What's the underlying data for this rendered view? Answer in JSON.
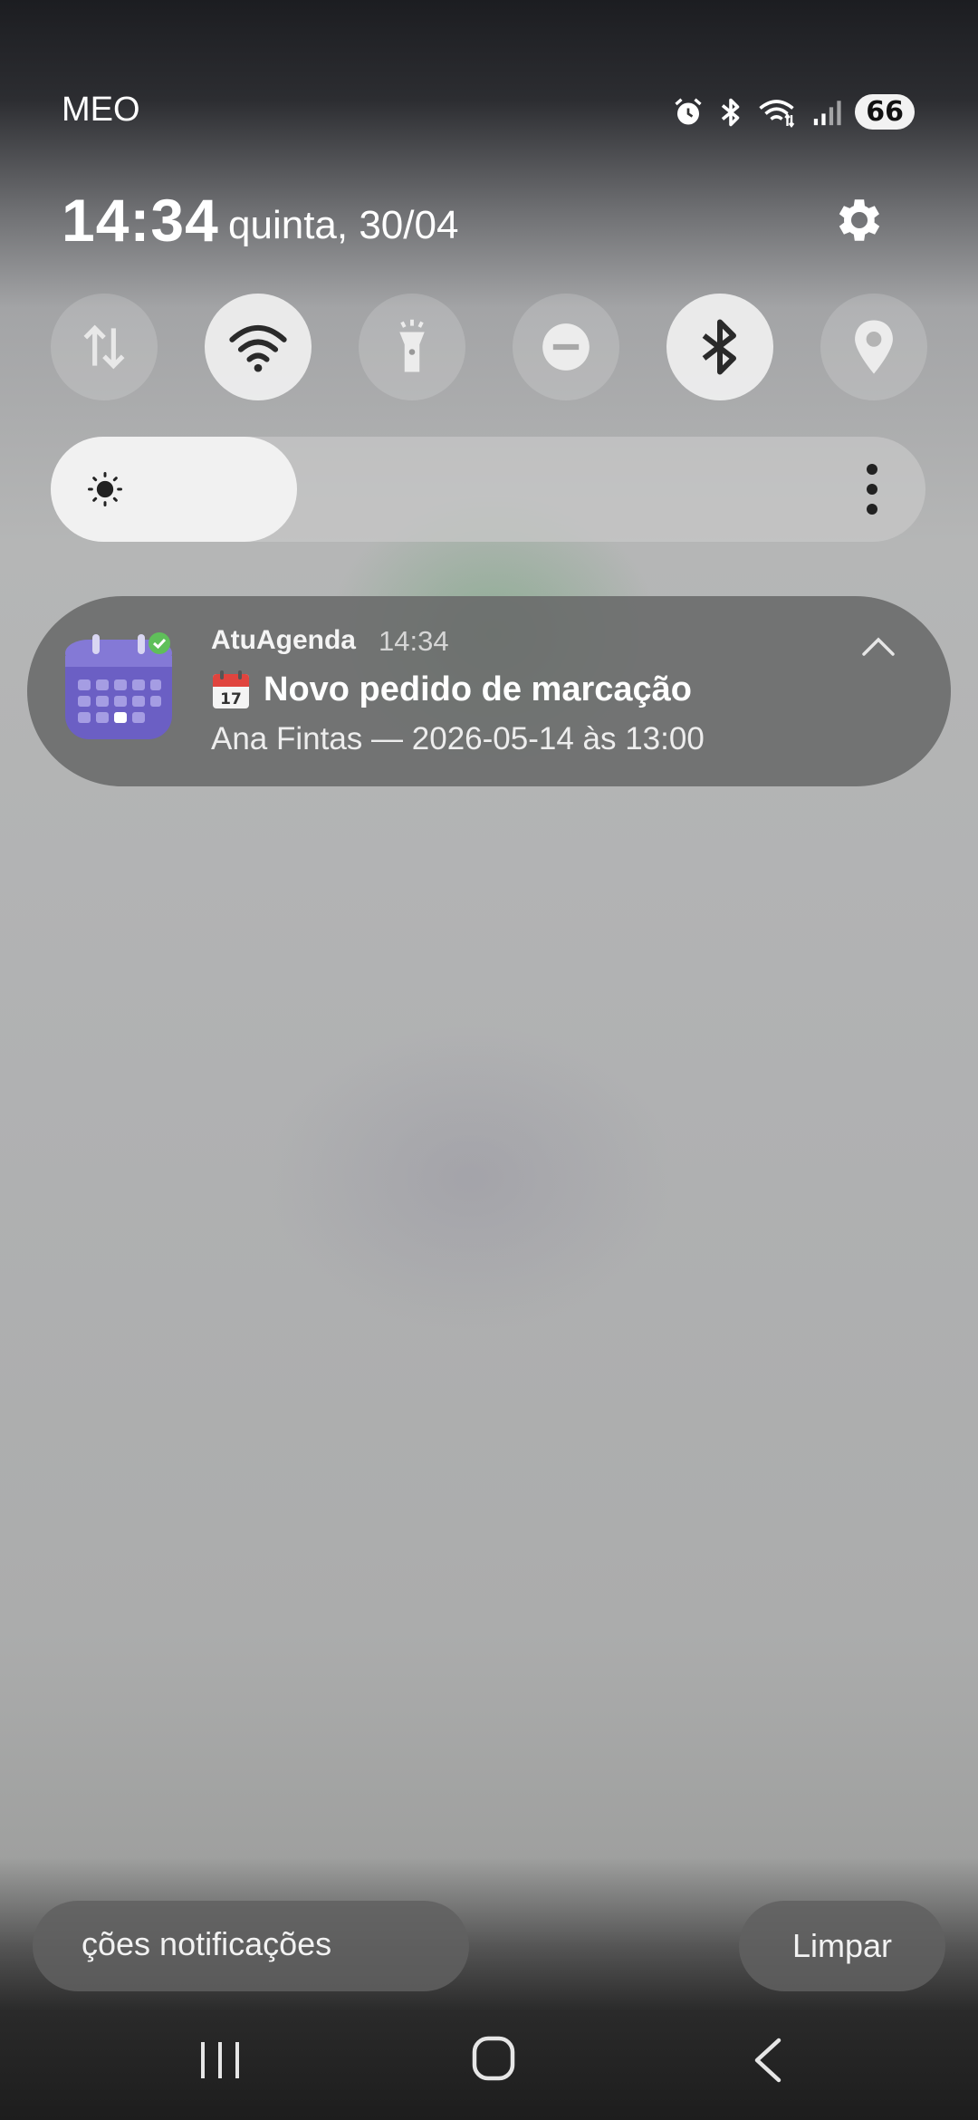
{
  "status_bar": {
    "carrier": "MEO",
    "battery": "66",
    "icons": [
      "alarm-icon",
      "bluetooth-icon",
      "wifi-icon",
      "signal-icon"
    ]
  },
  "header": {
    "time": "14:34",
    "date": "quinta, 30/04",
    "settings_icon": "gear-icon"
  },
  "quick_tiles": [
    {
      "name": "mobile-data",
      "icon": "data-arrows-icon",
      "active": false
    },
    {
      "name": "wifi",
      "icon": "wifi-icon",
      "active": true
    },
    {
      "name": "flashlight",
      "icon": "flashlight-icon",
      "active": false
    },
    {
      "name": "do-not-disturb",
      "icon": "minus-circle-icon",
      "active": false
    },
    {
      "name": "bluetooth",
      "icon": "bluetooth-icon",
      "active": true
    },
    {
      "name": "location",
      "icon": "location-pin-icon",
      "active": false
    }
  ],
  "brightness": {
    "level_fraction": 0.19
  },
  "notification": {
    "app_name": "AtuAgenda",
    "time": "14:34",
    "title": "Novo pedido de marcação",
    "body": "Ana Fintas — 2026-05-14 às 13:00"
  },
  "bottom_buttons": {
    "settings_label": "ções notificações",
    "clear_label": "Limpar"
  },
  "colors": {
    "app_icon_purple": "#6b5fc4",
    "badge_green": "#5fbf5a"
  }
}
